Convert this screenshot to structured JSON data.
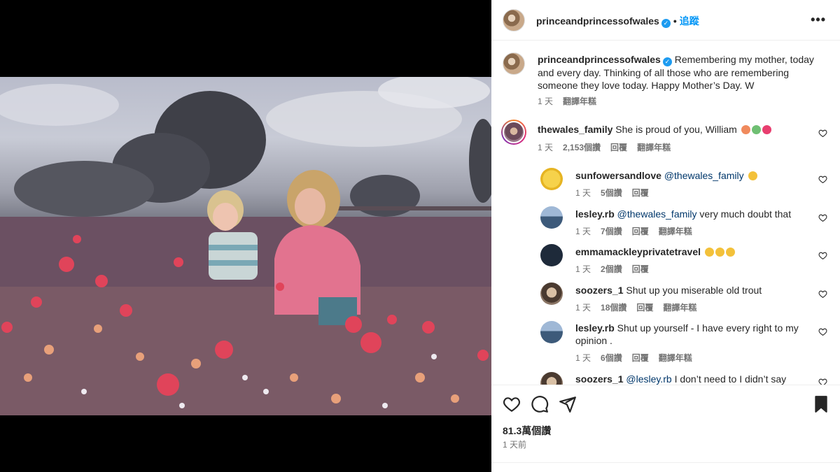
{
  "post": {
    "username": "princeandprincessofwales",
    "follow_label": "追蹤",
    "more_label": "•••",
    "caption": {
      "username": "princeandprincessofwales",
      "text": "Remembering my mother, today and every day. Thinking of all those who are remembering someone they love today. Happy Mother’s Day. W",
      "time": "1 天",
      "translate": "翻譯年糕"
    },
    "likes": "81.3萬個讚",
    "posted": "1 天前"
  },
  "comments": [
    {
      "username": "thewales_family",
      "text": "She is proud of you, William",
      "emojis": [
        "#f08a5d",
        "#6fbf73",
        "#e83e6f"
      ],
      "time": "1 天",
      "likes": "2,153個讚",
      "reply": "回覆",
      "translate": "翻譯年糕"
    },
    {
      "username": "sunfowersandlove",
      "mention": "@thewales_family",
      "text": "",
      "emojis": [
        "#f3c13a"
      ],
      "time": "1 天",
      "likes": "5個讚",
      "reply": "回覆"
    },
    {
      "username": "lesley.rb",
      "mention": "@thewales_family",
      "text": "very much doubt that",
      "time": "1 天",
      "likes": "7個讚",
      "reply": "回覆",
      "translate": "翻譯年糕"
    },
    {
      "username": "emmamackleyprivatetravel",
      "text": "",
      "emojis": [
        "#f3c13a",
        "#f3c13a",
        "#f3c13a"
      ],
      "time": "1 天",
      "likes": "2個讚",
      "reply": "回覆"
    },
    {
      "username": "soozers_1",
      "text": "Shut up you miserable old trout",
      "time": "1 天",
      "likes": "18個讚",
      "reply": "回覆",
      "translate": "翻譯年糕"
    },
    {
      "username": "lesley.rb",
      "text": "Shut up yourself - I have every right to my opinion .",
      "time": "1 天",
      "likes": "6個讚",
      "reply": "回覆",
      "translate": "翻譯年糕"
    },
    {
      "username": "soozers_1",
      "mention": "@lesley.rb",
      "text": "I don’t need to I didn’t say"
    }
  ]
}
